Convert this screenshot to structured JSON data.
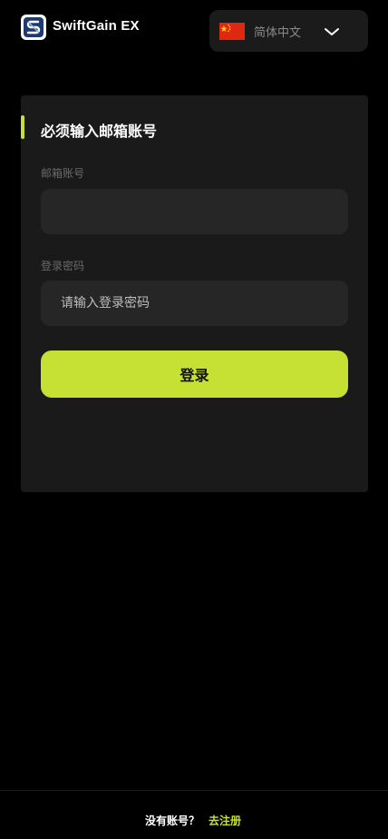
{
  "header": {
    "app_name": "SwiftGain EX",
    "language": "简体中文"
  },
  "form": {
    "title": "必须输入邮箱账号",
    "email_label": "邮箱账号",
    "email_value": "",
    "password_label": "登录密码",
    "password_placeholder": "请输入登录密码",
    "login_label": "登录"
  },
  "footer": {
    "no_account": "没有账号？",
    "register_link": "去注册"
  },
  "colors": {
    "accent": "#c6e033",
    "background": "#000000",
    "card": "#1a1a1a",
    "input": "#262626"
  },
  "icons": {
    "logo": "swiftgain-logo-icon",
    "flag": "china-flag-icon",
    "chevron": "chevron-down-icon"
  }
}
